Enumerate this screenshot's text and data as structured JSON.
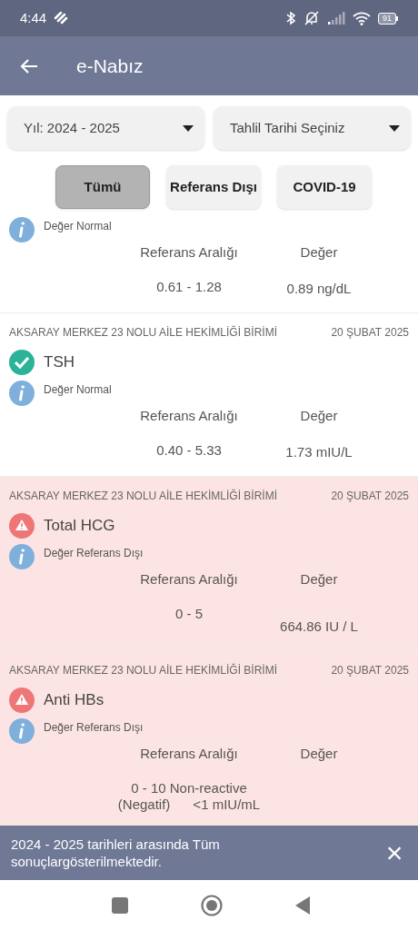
{
  "status_bar": {
    "time": "4:44",
    "battery": "91"
  },
  "app_bar": {
    "title": "e-Nabız"
  },
  "filters": [
    {
      "label": "Yıl: 2024 - 2025"
    },
    {
      "label": "Tahlil Tarihi Seçiniz"
    }
  ],
  "chips": [
    {
      "label": "Tümü",
      "selected": true
    },
    {
      "label": "Referans Dışı",
      "selected": false
    },
    {
      "label": "COVID-19",
      "selected": false
    }
  ],
  "results": [
    {
      "out_of_range": false,
      "note": "Değer Normal",
      "range_header": "Referans Aralığı",
      "value_header": "Değer",
      "range": "0.61 - 1.28",
      "value": "0.89 ng/dL"
    },
    {
      "out_of_range": false,
      "facility": "AKSARAY MERKEZ 23 NOLU AİLE HEKİMLİĞİ BİRİMİ",
      "date": "20 ŞUBAT 2025",
      "test": "TSH",
      "note": "Değer Normal",
      "range_header": "Referans Aralığı",
      "value_header": "Değer",
      "range": "0.40 - 5.33",
      "value": "1.73 mIU/L"
    },
    {
      "out_of_range": true,
      "facility": "AKSARAY MERKEZ 23 NOLU AİLE HEKİMLİĞİ BİRİMİ",
      "date": "20 ŞUBAT 2025",
      "test": "Total HCG",
      "note": "Değer Referans Dışı",
      "range_header": "Referans Aralığı",
      "value_header": "Değer",
      "range": "0 - 5",
      "value": "664.86 IU / L"
    },
    {
      "out_of_range": true,
      "facility": "AKSARAY MERKEZ 23 NOLU AİLE HEKİMLİĞİ BİRİMİ",
      "date": "20 ŞUBAT 2025",
      "test": "Anti HBs",
      "note": "Değer Referans Dışı",
      "range_header": "Referans Aralığı",
      "value_header": "Değer",
      "range": "0 - 10 Non-reactive (Negatif)      <1 mIU/mL"
    }
  ],
  "snackbar": {
    "message": "2024 - 2025 tarihleri arasında Tüm sonuçlargösterilmektedir.",
    "close": "×"
  }
}
